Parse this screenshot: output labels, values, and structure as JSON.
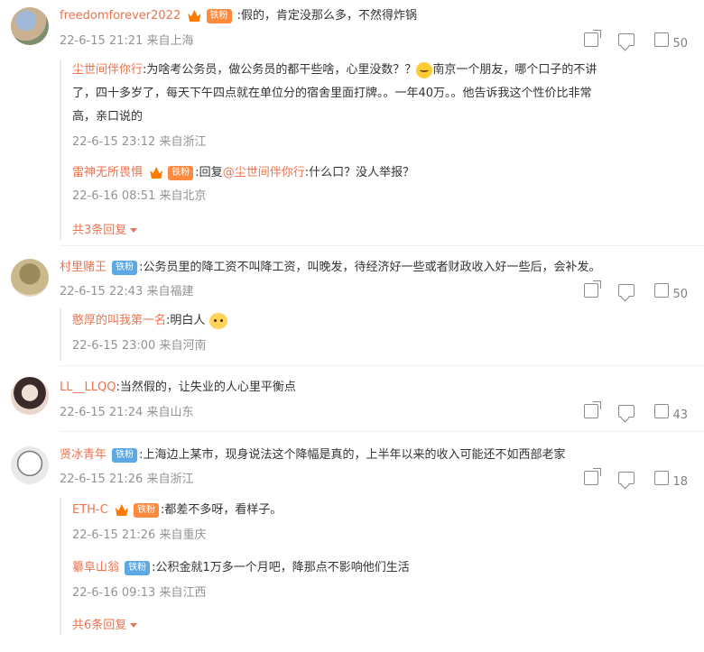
{
  "comments": [
    {
      "name": "freedomforever2022",
      "badge": "铁粉",
      "text": ":假的，肯定没那么多，不然得炸锅",
      "time": "22-6-15 21:21 来自上海",
      "likes": "50",
      "replies": [
        {
          "name": "尘世间伴你行",
          "text_1": ":为啥考公务员，做公务员的都干些啥，心里没数？？",
          "text_2": "南京一个朋友，哪个口子的不讲",
          "text_3": "了，四十多岁了，每天下午四点就在单位分的宿舍里面打牌。。一年40万。。他告诉我这个性价比非常",
          "text_4": "高，亲口说的",
          "time": "22-6-15 23:12 来自浙江"
        },
        {
          "name": "雷神无所畏惧",
          "badge": "铁粉",
          "text": ":回复",
          "mention": "@尘世间伴你行",
          "text_2": ":什么口？没人举报？",
          "time": "22-6-16 08:51 来自北京"
        }
      ],
      "more": "共3条回复"
    },
    {
      "name": "村里赌王",
      "badge": "铁粉",
      "text": ":公务员里的降工资不叫降工资，叫晚发，待经济好一些或者财政收入好一些后，会补发。",
      "time": "22-6-15 22:43 来自福建",
      "likes": "50",
      "replies": [
        {
          "name": "憨厚的叫我第一名",
          "text": ":明白人",
          "time": "22-6-15 23:00 来自河南"
        }
      ]
    },
    {
      "name": "LL__LLQQ",
      "text": ":当然假的，让失业的人心里平衡点",
      "time": "22-6-15 21:24 来自山东",
      "likes": "43"
    },
    {
      "name": "贤冰青年",
      "badge": "铁粉",
      "text": ":上海边上某市，现身说法这个降幅是真的，上半年以来的收入可能还不如西部老家",
      "time": "22-6-15 21:26 来自浙江",
      "likes": "18",
      "replies": [
        {
          "name": "ETH-C",
          "badge": "铁粉",
          "text": ":都差不多呀，看样子。",
          "time": "22-6-15 21:26 来自重庆"
        },
        {
          "name": "纂阜山翁",
          "badge": "铁粉",
          "text": ":公积金就1万多一个月吧，降那点不影响他们生活",
          "time": "22-6-16 09:13 来自江西"
        }
      ],
      "more": "共6条回复"
    }
  ]
}
